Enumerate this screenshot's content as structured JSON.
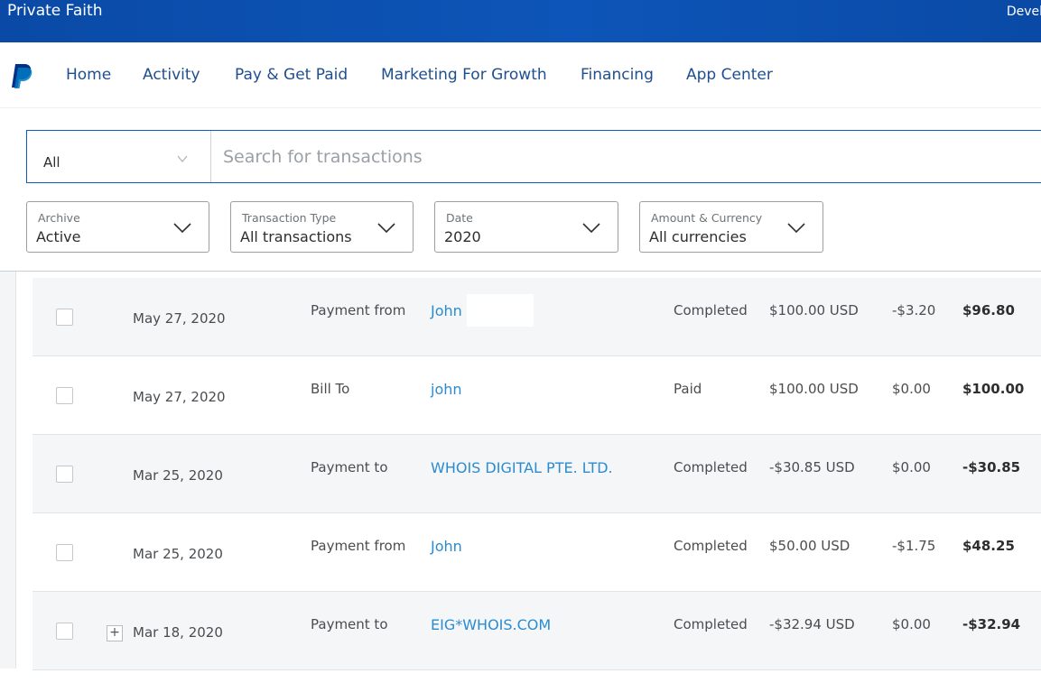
{
  "topbar": {
    "brand": "Private Faith",
    "right_text": "Devel"
  },
  "nav": {
    "logo_icon": "paypal-logo",
    "items": [
      "Home",
      "Activity",
      "Pay & Get Paid",
      "Marketing For Growth",
      "Financing",
      "App Center"
    ]
  },
  "search": {
    "category_value": "All",
    "placeholder": "Search for transactions"
  },
  "filters": [
    {
      "label": "Archive",
      "value": "Active"
    },
    {
      "label": "Transaction Type",
      "value": "All transactions"
    },
    {
      "label": "Date",
      "value": "2020"
    },
    {
      "label": "Amount & Currency",
      "value": "All currencies"
    }
  ],
  "transactions": [
    {
      "date": "May 27, 2020",
      "type": "Payment from",
      "name": "John",
      "status": "Completed",
      "gross": "$100.00 USD",
      "fee": "-$3.20",
      "net": "$96.80"
    },
    {
      "date": "May 27, 2020",
      "type": "Bill To",
      "name": "john",
      "status": "Paid",
      "gross": "$100.00 USD",
      "fee": "$0.00",
      "net": "$100.00"
    },
    {
      "date": "Mar 25, 2020",
      "type": "Payment to",
      "name": "WHOIS DIGITAL PTE. LTD.",
      "status": "Completed",
      "gross": "-$30.85 USD",
      "fee": "$0.00",
      "net": "-$30.85"
    },
    {
      "date": "Mar 25, 2020",
      "type": "Payment from",
      "name": "John",
      "status": "Completed",
      "gross": "$50.00 USD",
      "fee": "-$1.75",
      "net": "$48.25"
    },
    {
      "date": "Mar 18, 2020",
      "type": "Payment to",
      "name": "EIG*WHOIS.COM",
      "status": "Completed",
      "gross": "-$32.94 USD",
      "fee": "$0.00",
      "net": "-$32.94",
      "expand_symbol": "+"
    }
  ],
  "colors": {
    "topbar": "#0d55b8",
    "nav_link": "#1f4f8f",
    "name_link": "#2a8cd0",
    "search_border": "#0b5bc0"
  }
}
